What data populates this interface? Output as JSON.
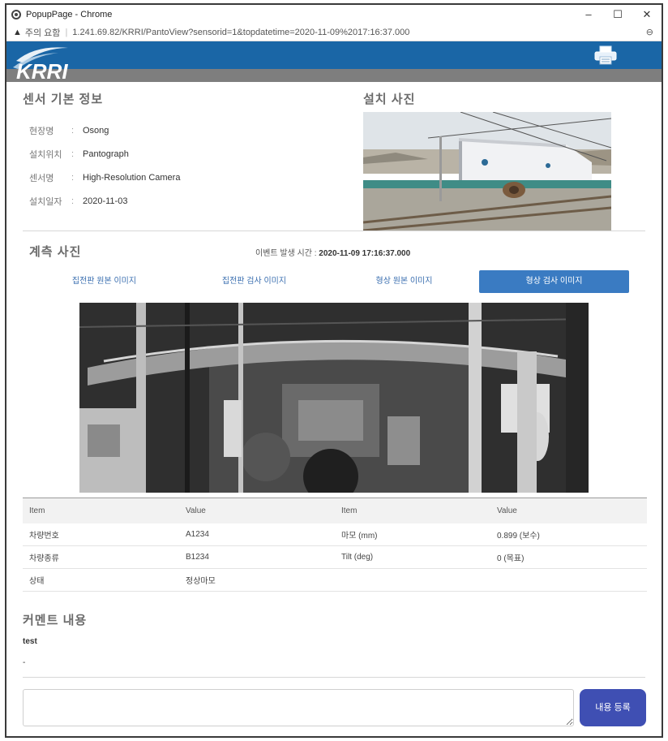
{
  "browser": {
    "title": "PopupPage - Chrome",
    "security_label": "주의 요함",
    "url": "1.241.69.82/KRRI/PantoView?sensorid=1&topdatetime=2020-11-09%2017:16:37.000",
    "controls": {
      "minimize": "–",
      "maximize": "☐",
      "close": "✕"
    }
  },
  "header": {
    "logo_text": "KRRI",
    "brand_color": "#1a66a6",
    "strip_color": "#7e7e7e",
    "print_icon": "printer-icon"
  },
  "sensor_info": {
    "title": "센서 기본 정보",
    "rows": [
      {
        "label": "현장명",
        "colon": ":",
        "value": "Osong"
      },
      {
        "label": "설치위치",
        "colon": ":",
        "value": "Pantograph"
      },
      {
        "label": "센서명",
        "colon": ":",
        "value": "High-Resolution Camera"
      },
      {
        "label": "설치일자",
        "colon": ":",
        "value": "2020-11-03"
      }
    ]
  },
  "install_photo": {
    "title": "설치 사진"
  },
  "measurement": {
    "title": "계측 사진",
    "event_time_label": "이벤트 발생 시간 :",
    "event_time_value": "2020-11-09 17:16:37.000",
    "tabs": [
      {
        "label": "집전판 원본 이미지",
        "active": false
      },
      {
        "label": "집전판 검사 이미지",
        "active": false
      },
      {
        "label": "형상 원본 이미지",
        "active": false
      },
      {
        "label": "형상 검사 이미지",
        "active": true
      }
    ]
  },
  "table": {
    "headers": [
      "Item",
      "Value",
      "Item",
      "Value"
    ],
    "rows": [
      [
        "차량번호",
        "A1234",
        "마모 (mm)",
        "0.899 (보수)"
      ],
      [
        "차량종류",
        "B1234",
        "Tilt (deg)",
        "0 (목표)"
      ],
      [
        "상태",
        "정상마모",
        "",
        ""
      ]
    ]
  },
  "comments": {
    "title": "커멘트 내용",
    "text": "test",
    "dash": "-",
    "input_value": "",
    "submit_label": "내용 등록",
    "accent": "#3f4fb3"
  }
}
